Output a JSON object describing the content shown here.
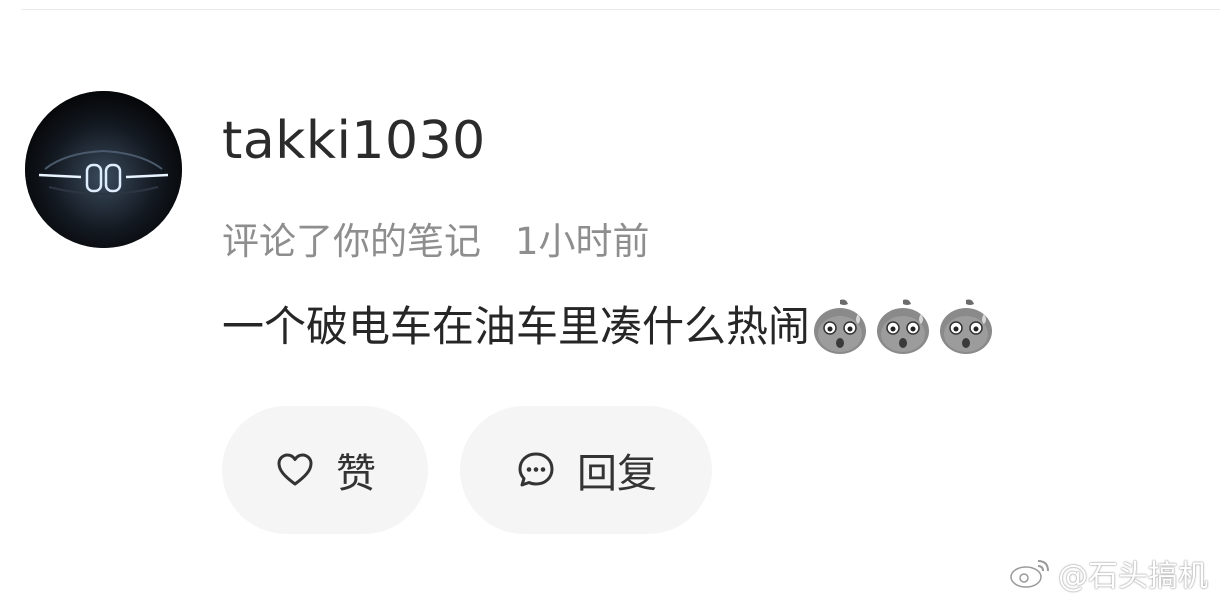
{
  "comment": {
    "username": "takki1030",
    "action_text": "评论了你的笔记",
    "time_ago": "1小时前",
    "text": "一个破电车在油车里凑什么热闹",
    "emojis": [
      "sweating-face-emoji",
      "sweating-face-emoji",
      "sweating-face-emoji"
    ]
  },
  "actions": {
    "like_label": "赞",
    "reply_label": "回复"
  },
  "watermark": {
    "text": "@石头搞机",
    "logo_icon": "weibo-logo-icon"
  },
  "colors": {
    "button_bg": "#f5f5f5",
    "meta_text": "#8e8e8e",
    "primary_text": "#262626"
  }
}
